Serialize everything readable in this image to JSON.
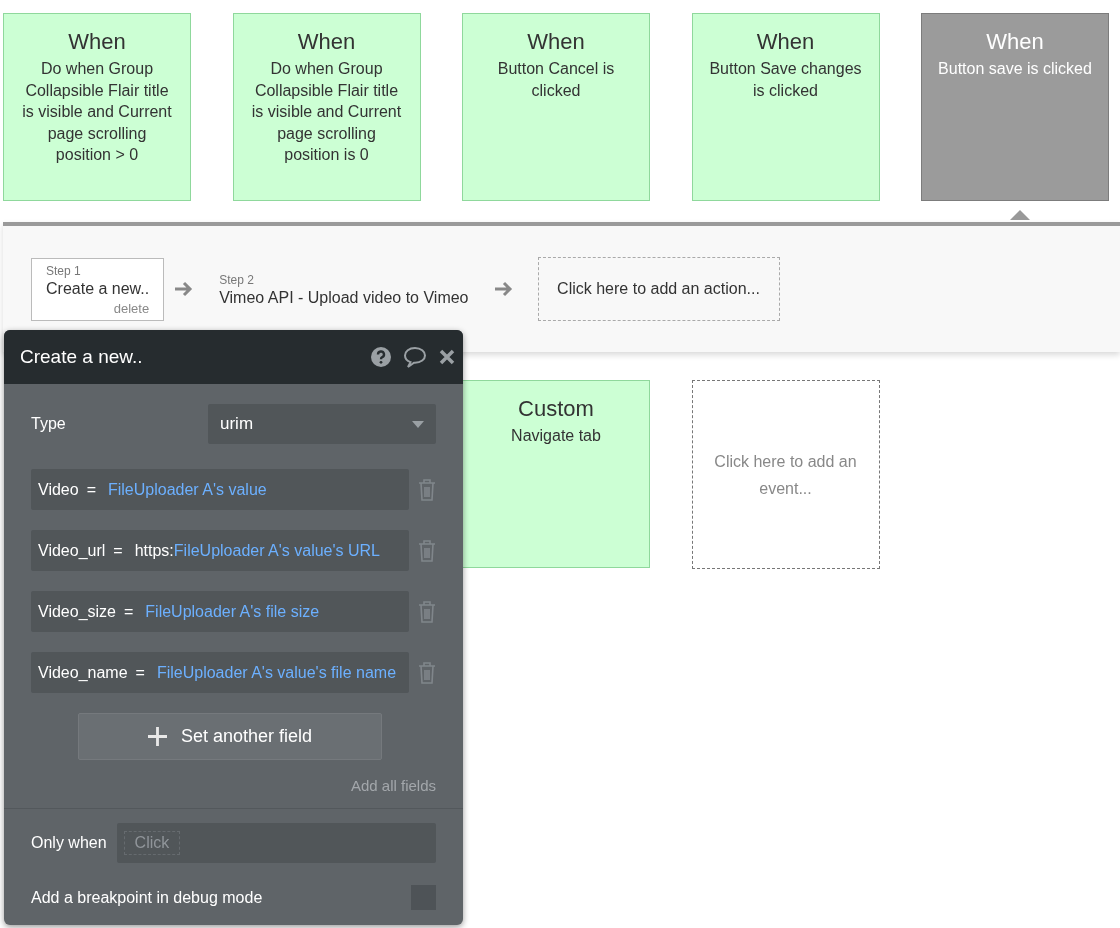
{
  "events_top": [
    {
      "title": "When",
      "text": "Do when Group Collapsible Flair title is visible and Current page scrolling position > 0",
      "selected": false
    },
    {
      "title": "When",
      "text": "Do when Group Collapsible Flair title is visible and Current page scrolling position is 0",
      "selected": false
    },
    {
      "title": "When",
      "text": "Button Cancel is clicked",
      "selected": false
    },
    {
      "title": "When",
      "text": "Button Save changes is clicked",
      "selected": false
    },
    {
      "title": "When",
      "text": "Button save is clicked",
      "selected": true
    }
  ],
  "workflow": {
    "steps": [
      {
        "label": "Step 1",
        "title": "Create a new..",
        "action": "delete",
        "selected": true
      },
      {
        "label": "Step 2",
        "title": "Vimeo API - Upload video to Vimeo",
        "selected": false
      }
    ],
    "add_action": "Click here to add an action..."
  },
  "events_bottom": [
    {
      "kind": "event",
      "title": "Custom",
      "text": "Navigate tab"
    },
    {
      "kind": "add",
      "text": "Click here to add an event..."
    }
  ],
  "action_panel": {
    "title": "Create a new..",
    "type_label": "Type",
    "type_value": "urim",
    "fields": [
      {
        "name": "Video",
        "operator": "=",
        "value": "FileUploader A's value"
      },
      {
        "name": "Video_url",
        "operator": "=",
        "literal": "https:",
        "value": "FileUploader A's value's URL"
      },
      {
        "name": "Video_size",
        "operator": "=",
        "value": "FileUploader A's file size"
      },
      {
        "name": "Video_name",
        "operator": "=",
        "value": "FileUploader A's value's file name"
      }
    ],
    "set_field_button": "Set another field",
    "add_all_link": "Add all fields",
    "only_when_label": "Only when",
    "only_when_placeholder": "Click",
    "breakpoint_label": "Add a breakpoint in debug mode",
    "breakpoint_checked": false
  }
}
